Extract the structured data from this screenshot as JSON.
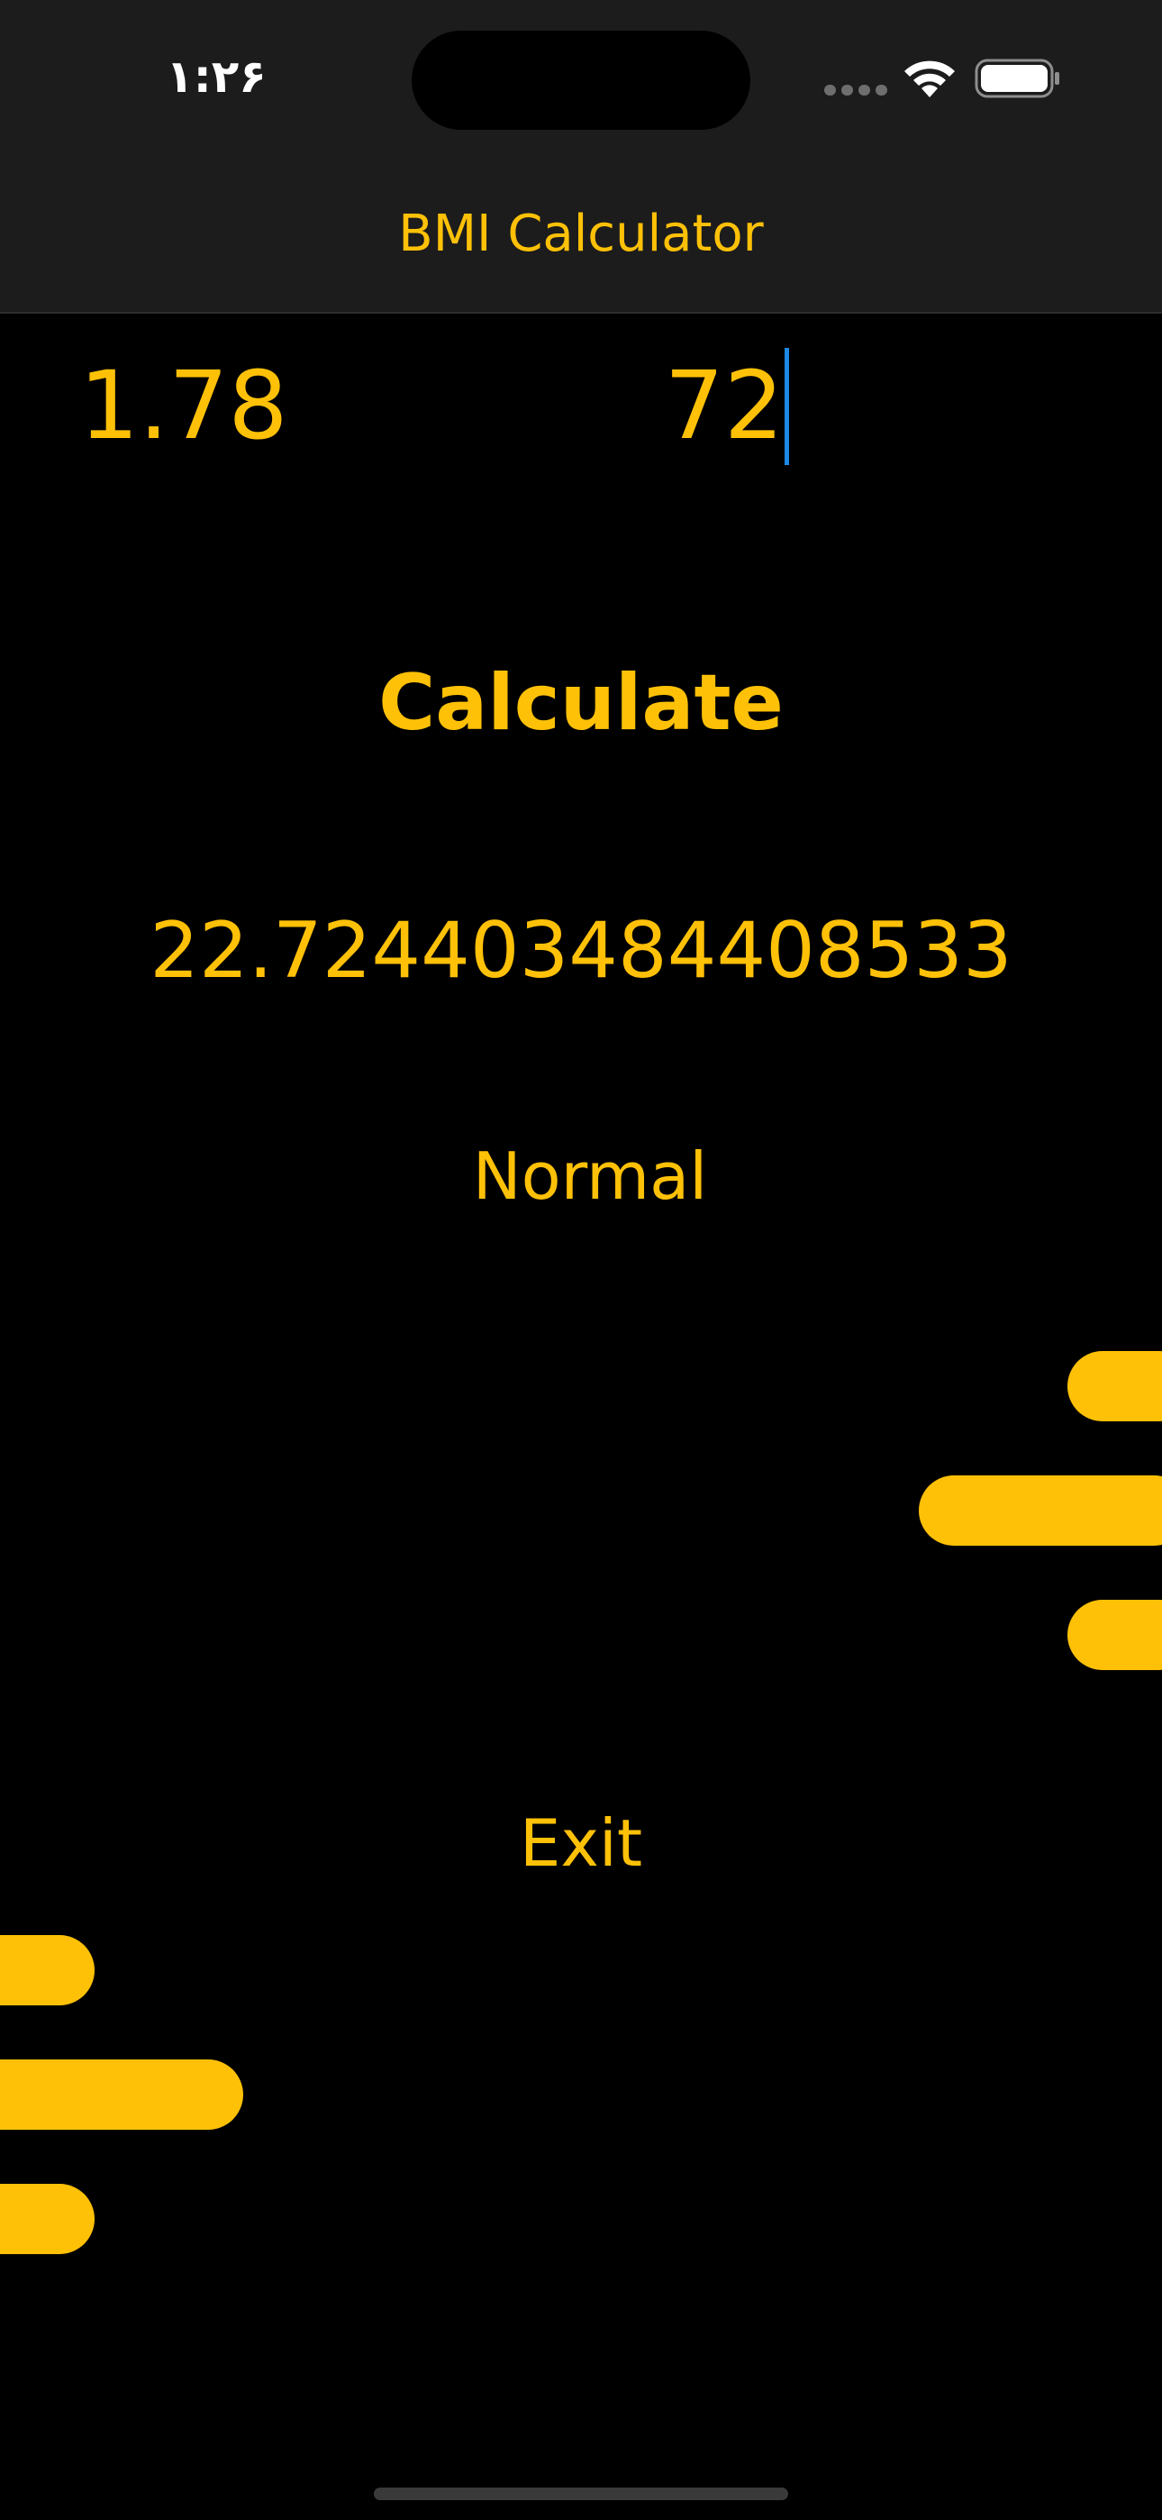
{
  "status_bar": {
    "time": "۱:۲۶",
    "icons": [
      "cellular-signal-icon",
      "wifi-icon",
      "battery-icon"
    ]
  },
  "app_bar": {
    "title": "BMI Calculator"
  },
  "inputs": {
    "height_value": "1.78",
    "weight_value": "72"
  },
  "actions": {
    "calculate_label": "Calculate",
    "exit_label": "Exit"
  },
  "result": {
    "bmi_value": "22.724403484408533",
    "category": "Normal"
  },
  "colors": {
    "accent": "#FFC107",
    "background": "#000000",
    "app_bar": "#1C1C1C",
    "caret": "#1E88E5"
  }
}
